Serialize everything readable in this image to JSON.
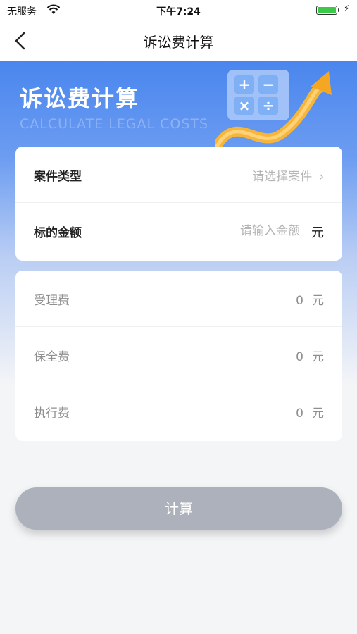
{
  "status_bar": {
    "carrier": "无服务",
    "time": "下午7:24"
  },
  "nav": {
    "title": "诉讼费计算"
  },
  "banner": {
    "title": "诉讼费计算",
    "subtitle": "CALCULATE LEGAL COSTS",
    "icon": "calculator-arrow-illustration",
    "calc_symbols": [
      "+",
      "−",
      "×",
      "÷"
    ]
  },
  "form": {
    "case_type": {
      "label": "案件类型",
      "placeholder": "请选择案件",
      "chevron": "›"
    },
    "amount": {
      "label": "标的金额",
      "placeholder": "请输入金额",
      "value": "",
      "unit": "元"
    }
  },
  "results": [
    {
      "label": "受理费",
      "value": "0",
      "unit": "元"
    },
    {
      "label": "保全费",
      "value": "0",
      "unit": "元"
    },
    {
      "label": "执行费",
      "value": "0",
      "unit": "元"
    }
  ],
  "calculate_button": {
    "label": "计算"
  },
  "colors": {
    "banner_top": "#4a86ee",
    "button_disabled": "#acb1bc",
    "battery": "#3cc94a"
  }
}
